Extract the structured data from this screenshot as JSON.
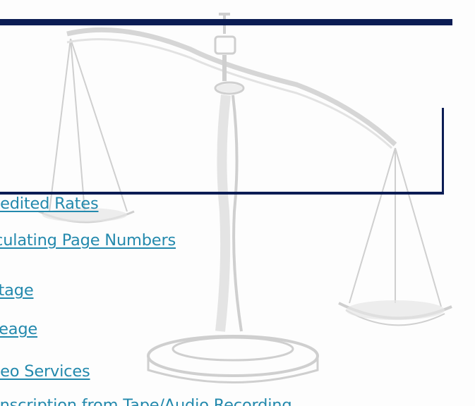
{
  "colors": {
    "rule": "#0b1c54",
    "link": "#2389ad",
    "watermark": "#d9d9d9"
  },
  "decoration": {
    "watermark_icon": "scales-of-justice-icon"
  },
  "links": [
    {
      "label": "pedited Rates"
    },
    {
      "label": "lculating Page Numbers"
    },
    {
      "label": "stage"
    },
    {
      "label": "ileage"
    },
    {
      "label": "deo Services"
    },
    {
      "label": "anscription from Tape/Audio Recording"
    }
  ]
}
